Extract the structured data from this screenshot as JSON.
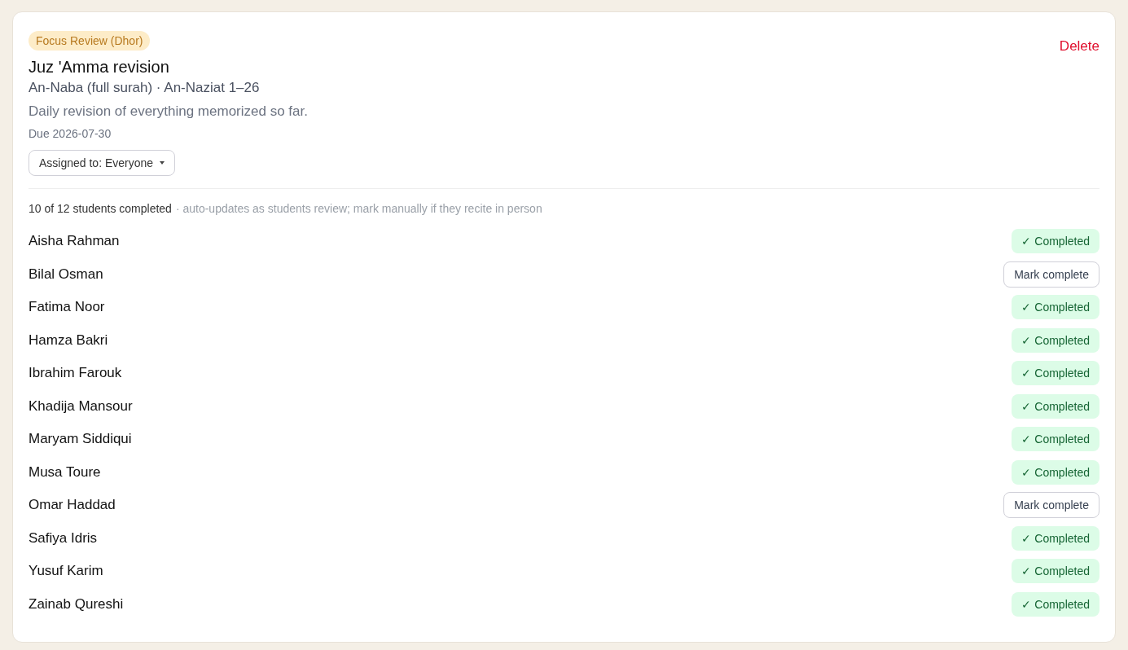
{
  "task": {
    "tag": "Focus Review (Dhor)",
    "delete_label": "Delete",
    "title": "Juz 'Amma revision",
    "range": "An-Naba (full surah) · An-Naziat 1–26",
    "description": "Daily revision of everything memorized so far.",
    "due": "Due 2026-07-30",
    "assigned": "Assigned to: Everyone"
  },
  "summary": {
    "count": "10 of 12 students completed",
    "note": "· auto-updates as students review; mark manually if they recite in person"
  },
  "students": [
    {
      "name": "Aisha Rahman",
      "completed": true,
      "action": "✓ Completed"
    },
    {
      "name": "Bilal Osman",
      "completed": false,
      "action": "Mark complete"
    },
    {
      "name": "Fatima Noor",
      "completed": true,
      "action": "✓ Completed"
    },
    {
      "name": "Hamza Bakri",
      "completed": true,
      "action": "✓ Completed"
    },
    {
      "name": "Ibrahim Farouk",
      "completed": true,
      "action": "✓ Completed"
    },
    {
      "name": "Khadija Mansour",
      "completed": true,
      "action": "✓ Completed"
    },
    {
      "name": "Maryam Siddiqui",
      "completed": true,
      "action": "✓ Completed"
    },
    {
      "name": "Musa Toure",
      "completed": true,
      "action": "✓ Completed"
    },
    {
      "name": "Omar Haddad",
      "completed": false,
      "action": "Mark complete"
    },
    {
      "name": "Safiya Idris",
      "completed": true,
      "action": "✓ Completed"
    },
    {
      "name": "Yusuf Karim",
      "completed": true,
      "action": "✓ Completed"
    },
    {
      "name": "Zainab Qureshi",
      "completed": true,
      "action": "✓ Completed"
    }
  ]
}
